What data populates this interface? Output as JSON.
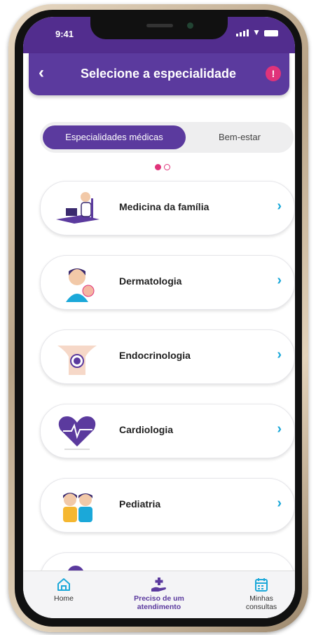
{
  "status": {
    "time": "9:41"
  },
  "header": {
    "back_icon": "chevron-left-icon",
    "title": "Selecione a especialidade",
    "alert_icon": "!"
  },
  "segment": {
    "active_label": "Especialidades médicas",
    "inactive_label": "Bem-estar"
  },
  "pager": {
    "pages": 2,
    "current": 1
  },
  "specialties": [
    {
      "label": "Medicina da família",
      "icon": "doctor-at-desk-icon"
    },
    {
      "label": "Dermatologia",
      "icon": "skin-person-icon"
    },
    {
      "label": "Endocrinologia",
      "icon": "thyroid-neck-icon"
    },
    {
      "label": "Cardiologia",
      "icon": "heart-pulse-icon"
    },
    {
      "label": "Pediatria",
      "icon": "children-icon"
    }
  ],
  "tabbar": {
    "home": "Home",
    "request": "Preciso de um atendimento",
    "appointments": "Minhas consultas"
  },
  "colors": {
    "primary": "#5b3a9e",
    "accent": "#e0337a",
    "chevron": "#1ba8d9"
  }
}
